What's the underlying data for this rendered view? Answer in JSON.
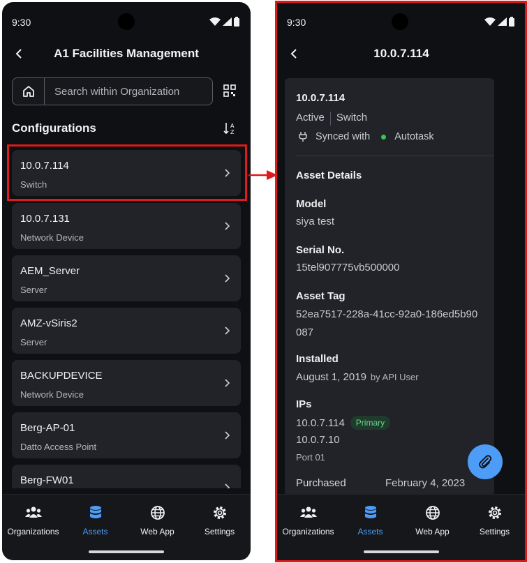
{
  "left": {
    "status": {
      "time": "9:30"
    },
    "app_bar": {
      "title": "A1 Facilities Management"
    },
    "search": {
      "placeholder": "Search within Organization"
    },
    "section_title": "Configurations",
    "items": [
      {
        "name": "10.0.7.114",
        "type": "Switch"
      },
      {
        "name": "10.0.7.131",
        "type": "Network Device"
      },
      {
        "name": "AEM_Server",
        "type": "Server"
      },
      {
        "name": "AMZ-vSiris2",
        "type": "Server"
      },
      {
        "name": "BACKUPDEVICE",
        "type": "Network Device"
      },
      {
        "name": "Berg-AP-01",
        "type": "Datto Access Point"
      },
      {
        "name": "Berg-FW01",
        "type": ""
      }
    ]
  },
  "right": {
    "status": {
      "time": "9:30"
    },
    "app_bar": {
      "title": "10.0.7.114"
    },
    "card": {
      "title": "10.0.7.114",
      "status": "Active",
      "type": "Switch",
      "sync_label": "Synced with",
      "sync_target": "Autotask",
      "section": "Asset Details",
      "model_label": "Model",
      "model": "siya test",
      "serial_label": "Serial No.",
      "serial": "15tel907775vb500000",
      "tag_label": "Asset Tag",
      "tag_line1": "52ea7517-228a-41cc-92a0-186ed5b90",
      "tag_line2": "087",
      "installed_label": "Installed",
      "installed": "August 1, 2019",
      "installed_by": "by API User",
      "ips_label": "IPs",
      "ip1": "10.0.7.114",
      "ip1_badge": "Primary",
      "ip2": "10.0.7.10",
      "ip2_port": "Port 01",
      "purchased_label": "Purchased",
      "purchased": "February 4, 2023"
    }
  },
  "nav": [
    {
      "label": "Organizations",
      "icon": "people-icon"
    },
    {
      "label": "Assets",
      "icon": "database-icon"
    },
    {
      "label": "Web App",
      "icon": "globe-icon"
    },
    {
      "label": "Settings",
      "icon": "gear-icon"
    }
  ],
  "colors": {
    "accent": "#4d9df8",
    "highlight": "#e0191b",
    "sync_dot": "#34c759"
  }
}
